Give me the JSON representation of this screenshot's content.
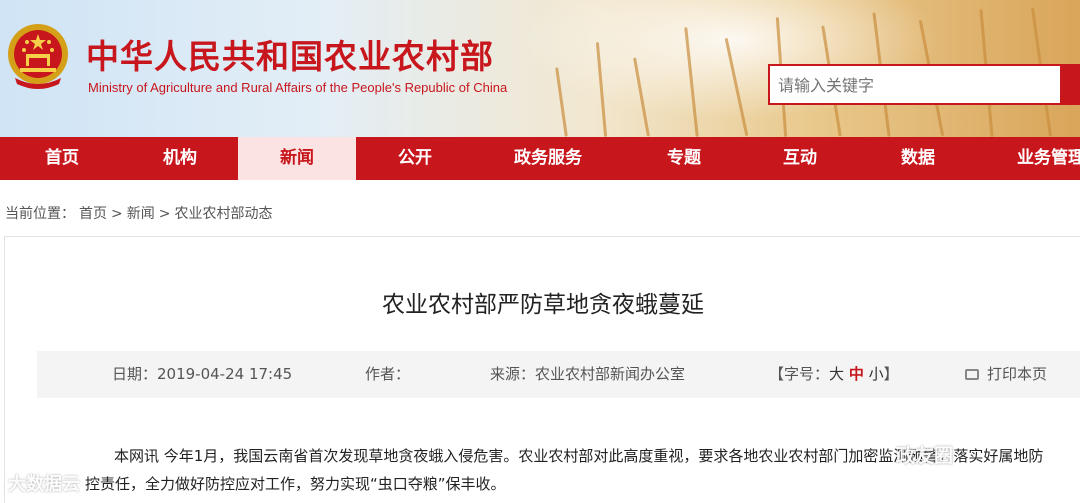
{
  "header": {
    "title_cn": "中华人民共和国农业农村部",
    "title_en": "Ministry of Agriculture and Rural Affairs of the People's Republic of China",
    "search_placeholder": "请输入关键字"
  },
  "nav": {
    "items": [
      {
        "label": "首页",
        "active": false
      },
      {
        "label": "机构",
        "active": false
      },
      {
        "label": "新闻",
        "active": true
      },
      {
        "label": "公开",
        "active": false
      },
      {
        "label": "政务服务",
        "active": false
      },
      {
        "label": "专题",
        "active": false
      },
      {
        "label": "互动",
        "active": false
      },
      {
        "label": "数据",
        "active": false
      },
      {
        "label": "业务管理",
        "active": false
      }
    ]
  },
  "breadcrumb": {
    "prefix": "当前位置：",
    "items": [
      "首页",
      "新闻",
      "农业农村部动态"
    ],
    "separator": ">"
  },
  "article": {
    "title": "农业农村部严防草地贪夜蛾蔓延",
    "date": "日期：2019-04-24 17:45",
    "author": "作者：",
    "source": "来源：农业农村部新闻办公室",
    "font_size_prefix": "【字号：",
    "font_size_large": "大",
    "font_size_medium": "中",
    "font_size_small": "小",
    "font_size_suffix": "】",
    "print_label": "打印本页",
    "paragraph_1": "本网讯 今年1月，我国云南省首次发现草地贪夜蛾入侵危害。农业农村部对此高度重视，要求各地农业农村部门加密监测预警，落实好属地防",
    "paragraph_2": "控责任，全力做好防控应对工作，努力实现“虫口夺粮”保丰收。"
  },
  "watermarks": {
    "left": "大数据云",
    "right": "政友圈"
  },
  "colors": {
    "brand_red": "#c8161d",
    "active_tab_bg": "#fbe3e3"
  }
}
